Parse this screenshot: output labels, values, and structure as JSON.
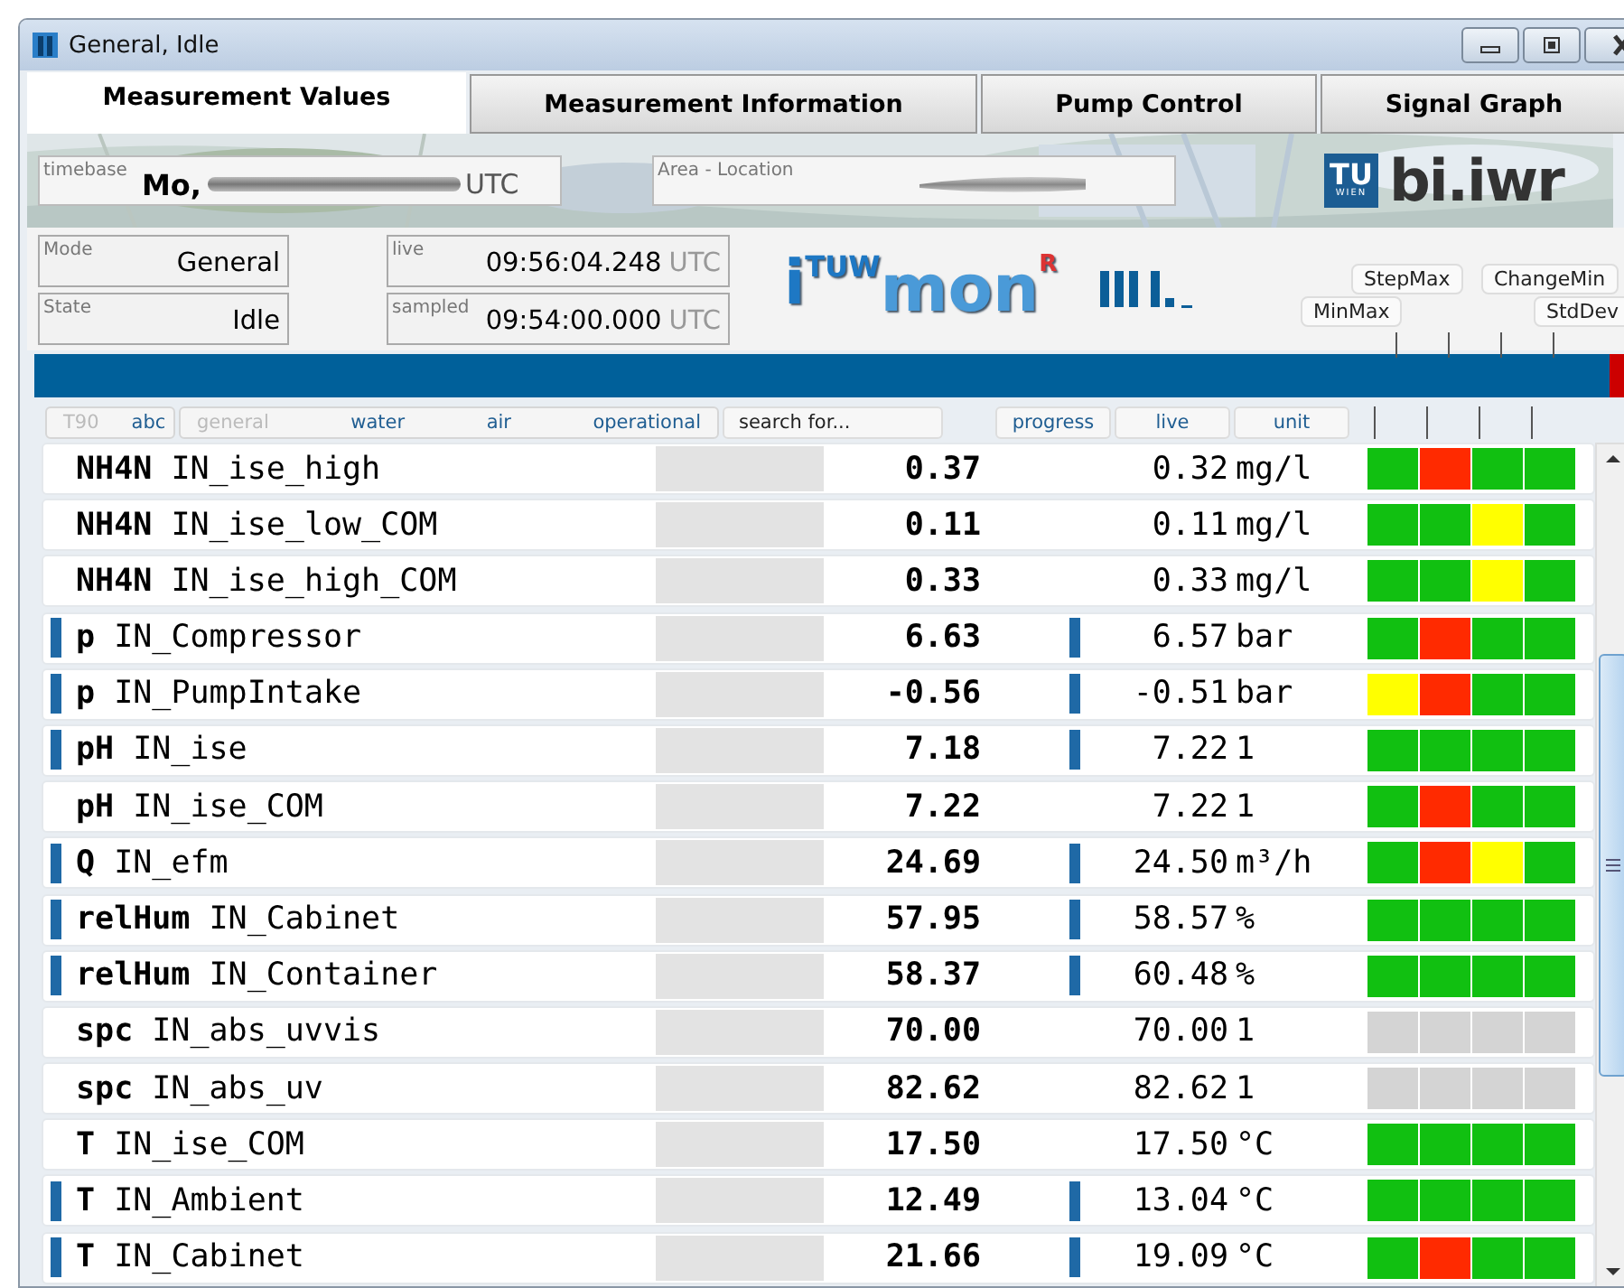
{
  "window": {
    "title": "General, Idle"
  },
  "tabs": [
    {
      "label": "Measurement Values",
      "selected": true
    },
    {
      "label": "Measurement Information",
      "selected": false
    },
    {
      "label": "Pump Control",
      "selected": false
    },
    {
      "label": "Signal Graph",
      "selected": false
    }
  ],
  "header": {
    "timebase": {
      "label": "timebase",
      "value": "Mo,",
      "unit": "UTC"
    },
    "area_location": {
      "label": "Area - Location"
    },
    "tu_logo": {
      "top": "TU",
      "bottom": "WIEN"
    },
    "institute": "bi.iwr"
  },
  "status": {
    "mode": {
      "label": "Mode",
      "value": "General"
    },
    "state": {
      "label": "State",
      "value": "Idle"
    },
    "live": {
      "label": "live",
      "value": "09:56:04.248",
      "unit": "UTC"
    },
    "sampled": {
      "label": "sampled",
      "value": "09:54:00.000",
      "unit": "UTC"
    }
  },
  "app_logo": {
    "prefix": "i",
    "superscript": "TUW",
    "name": "mon",
    "mark": "R"
  },
  "indicators": [
    "MinMax",
    "StepMax",
    "ChangeMin",
    "StdDev"
  ],
  "filter_groups": [
    [
      {
        "label": "T90",
        "disabled": true
      },
      {
        "label": "abc",
        "disabled": false
      }
    ],
    [
      {
        "label": "general",
        "disabled": true
      },
      {
        "label": "water",
        "disabled": false
      },
      {
        "label": "air",
        "disabled": false
      },
      {
        "label": "operational",
        "disabled": false
      }
    ]
  ],
  "search": {
    "placeholder": "search for..."
  },
  "columns": [
    "progress",
    "live",
    "unit"
  ],
  "rows": [
    {
      "quantity": "NH4N",
      "name": "IN_ise_high",
      "marker": false,
      "value": "0.37",
      "live_marker": false,
      "live": "0.32",
      "unit": "mg/l",
      "flags": [
        {
          "color": "#11c011"
        },
        {
          "color": "#ff2a00"
        },
        {
          "color": "#11c011"
        },
        {
          "color": "#11c011"
        }
      ]
    },
    {
      "quantity": "NH4N",
      "name": "IN_ise_low_COM",
      "marker": false,
      "value": "0.11",
      "live_marker": false,
      "live": "0.11",
      "unit": "mg/l",
      "flags": [
        {
          "color": "#11c011"
        },
        {
          "color": "#11c011"
        },
        {
          "color": "#ffff00"
        },
        {
          "color": "#11c011"
        }
      ]
    },
    {
      "quantity": "NH4N",
      "name": "IN_ise_high_COM",
      "marker": false,
      "value": "0.33",
      "live_marker": false,
      "live": "0.33",
      "unit": "mg/l",
      "flags": [
        {
          "color": "#11c011"
        },
        {
          "color": "#11c011"
        },
        {
          "color": "#ffff00"
        },
        {
          "color": "#11c011"
        }
      ]
    },
    {
      "quantity": "p",
      "name": "IN_Compressor",
      "marker": true,
      "value": "6.63",
      "live_marker": true,
      "live": "6.57",
      "unit": "bar",
      "flags": [
        {
          "color": "#11c011"
        },
        {
          "color": "#ff2a00"
        },
        {
          "color": "#11c011"
        },
        {
          "color": "#11c011"
        }
      ]
    },
    {
      "quantity": "p",
      "name": "IN_PumpIntake",
      "marker": true,
      "value": "-0.56",
      "live_marker": true,
      "live": "-0.51",
      "unit": "bar",
      "flags": [
        {
          "color": "#ffff00"
        },
        {
          "color": "#ff2a00"
        },
        {
          "color": "#11c011"
        },
        {
          "color": "#11c011"
        }
      ]
    },
    {
      "quantity": "pH",
      "name": "IN_ise",
      "marker": true,
      "value": "7.18",
      "live_marker": true,
      "live": "7.22",
      "unit": "1",
      "flags": [
        {
          "color": "#11c011"
        },
        {
          "color": "#11c011"
        },
        {
          "color": "#11c011"
        },
        {
          "color": "#11c011"
        }
      ]
    },
    {
      "quantity": "pH",
      "name": "IN_ise_COM",
      "marker": false,
      "value": "7.22",
      "live_marker": false,
      "live": "7.22",
      "unit": "1",
      "flags": [
        {
          "color": "#11c011"
        },
        {
          "color": "#ff2a00"
        },
        {
          "color": "#11c011"
        },
        {
          "color": "#11c011"
        }
      ]
    },
    {
      "quantity": "Q",
      "name": "IN_efm",
      "marker": true,
      "value": "24.69",
      "live_marker": true,
      "live": "24.50",
      "unit": "m³/h",
      "flags": [
        {
          "color": "#11c011"
        },
        {
          "color": "#ff2a00"
        },
        {
          "color": "#ffff00"
        },
        {
          "color": "#11c011"
        }
      ]
    },
    {
      "quantity": "relHum",
      "name": "IN_Cabinet",
      "marker": true,
      "value": "57.95",
      "live_marker": true,
      "live": "58.57",
      "unit": "%",
      "flags": [
        {
          "color": "#11c011"
        },
        {
          "color": "#11c011"
        },
        {
          "color": "#11c011"
        },
        {
          "color": "#11c011"
        }
      ]
    },
    {
      "quantity": "relHum",
      "name": "IN_Container",
      "marker": true,
      "value": "58.37",
      "live_marker": true,
      "live": "60.48",
      "unit": "%",
      "flags": [
        {
          "color": "#11c011"
        },
        {
          "color": "#11c011"
        },
        {
          "color": "#11c011"
        },
        {
          "color": "#11c011"
        }
      ]
    },
    {
      "quantity": "spc",
      "name": "IN_abs_uvvis",
      "marker": false,
      "value": "70.00",
      "live_marker": false,
      "live": "70.00",
      "unit": "1",
      "flags": [
        {
          "color": "#d4d4d4"
        },
        {
          "color": "#d4d4d4"
        },
        {
          "color": "#d4d4d4"
        },
        {
          "color": "#d4d4d4"
        }
      ]
    },
    {
      "quantity": "spc",
      "name": "IN_abs_uv",
      "marker": false,
      "value": "82.62",
      "live_marker": false,
      "live": "82.62",
      "unit": "1",
      "flags": [
        {
          "color": "#d4d4d4"
        },
        {
          "color": "#d4d4d4"
        },
        {
          "color": "#d4d4d4"
        },
        {
          "color": "#d4d4d4"
        }
      ]
    },
    {
      "quantity": "T",
      "name": "IN_ise_COM",
      "marker": false,
      "value": "17.50",
      "live_marker": false,
      "live": "17.50",
      "unit": "°C",
      "flags": [
        {
          "color": "#11c011"
        },
        {
          "color": "#11c011"
        },
        {
          "color": "#11c011"
        },
        {
          "color": "#11c011"
        }
      ]
    },
    {
      "quantity": "T",
      "name": "IN_Ambient",
      "marker": true,
      "value": "12.49",
      "live_marker": true,
      "live": "13.04",
      "unit": "°C",
      "flags": [
        {
          "color": "#11c011"
        },
        {
          "color": "#11c011"
        },
        {
          "color": "#11c011"
        },
        {
          "color": "#11c011"
        }
      ]
    },
    {
      "quantity": "T",
      "name": "IN_Cabinet",
      "marker": true,
      "value": "21.66",
      "live_marker": true,
      "live": "19.09",
      "unit": "°C",
      "flags": [
        {
          "color": "#11c011"
        },
        {
          "color": "#ff2a00"
        },
        {
          "color": "#11c011"
        },
        {
          "color": "#11c011"
        }
      ]
    }
  ]
}
